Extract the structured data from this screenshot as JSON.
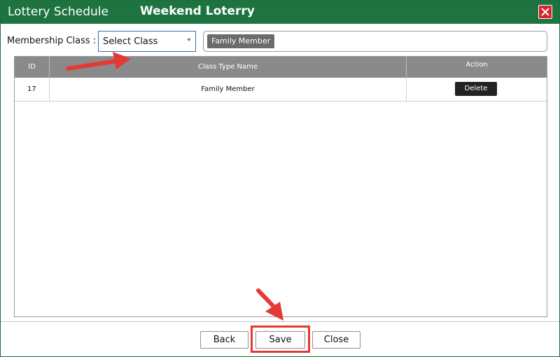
{
  "window": {
    "title": "Lottery Schedule",
    "subtitle": "Weekend Loterry",
    "close_icon": "close-icon"
  },
  "filter": {
    "membership_label": "Membership Class :",
    "select_value": "Select Class",
    "tags": [
      "Family Member"
    ]
  },
  "table": {
    "columns": [
      "ID",
      "Class Type Name",
      "Action"
    ],
    "rows": [
      {
        "id": "17",
        "name": "Family Member",
        "action_label": "Delete"
      }
    ]
  },
  "buttons": {
    "back": "Back",
    "save": "Save",
    "close": "Close"
  },
  "colors": {
    "title_bar": "#1e7440",
    "annotation": "#e53935"
  }
}
